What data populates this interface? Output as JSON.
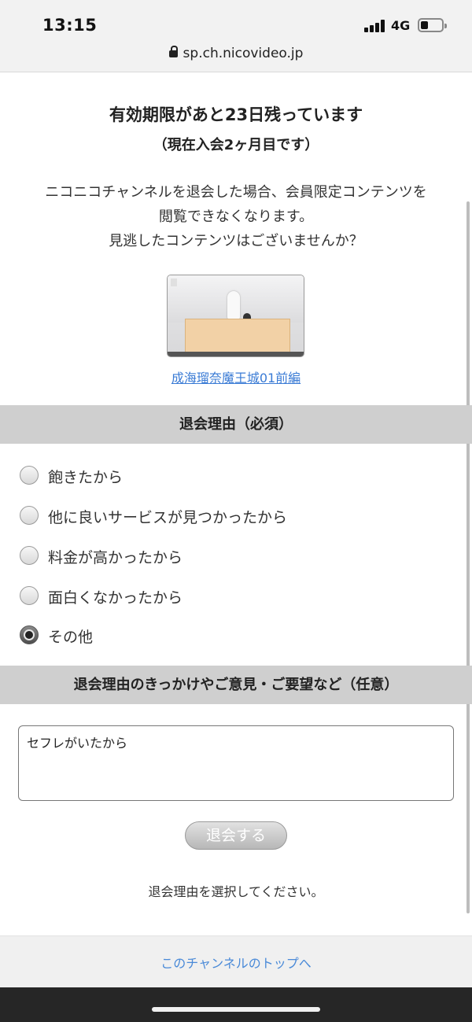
{
  "status_bar": {
    "time": "13:15",
    "network": "4G",
    "url": "sp.ch.nicovideo.jp"
  },
  "expiry": {
    "title": "有効期限があと23日残っています",
    "subtitle": "（現在入会2ヶ月目です）"
  },
  "notice": {
    "line1": "ニコニコチャンネルを退会した場合、会員限定コンテンツを",
    "line2": "閲覧できなくなります。",
    "line3": "見逃したコンテンツはございませんか？"
  },
  "video": {
    "link_text": "成海瑠奈魔王城01前編"
  },
  "reason_section": {
    "header": "退会理由（必須）",
    "options": [
      {
        "label": "飽きたから",
        "checked": false
      },
      {
        "label": "他に良いサービスが見つかったから",
        "checked": false
      },
      {
        "label": "料金が高かったから",
        "checked": false
      },
      {
        "label": "面白くなかったから",
        "checked": false
      },
      {
        "label": "その他",
        "checked": true
      }
    ]
  },
  "comment_section": {
    "header": "退会理由のきっかけやご意見・ご要望など（任意）",
    "value": "セフレがいたから"
  },
  "submit": {
    "label": "退会する"
  },
  "hint": "退会理由を選択してください。",
  "footer": {
    "link": "このチャンネルのトップへ"
  },
  "colors": {
    "link": "#3a7bd5",
    "section_header_bg": "#cfcfcf",
    "footer_bg": "#f0f0f0"
  }
}
